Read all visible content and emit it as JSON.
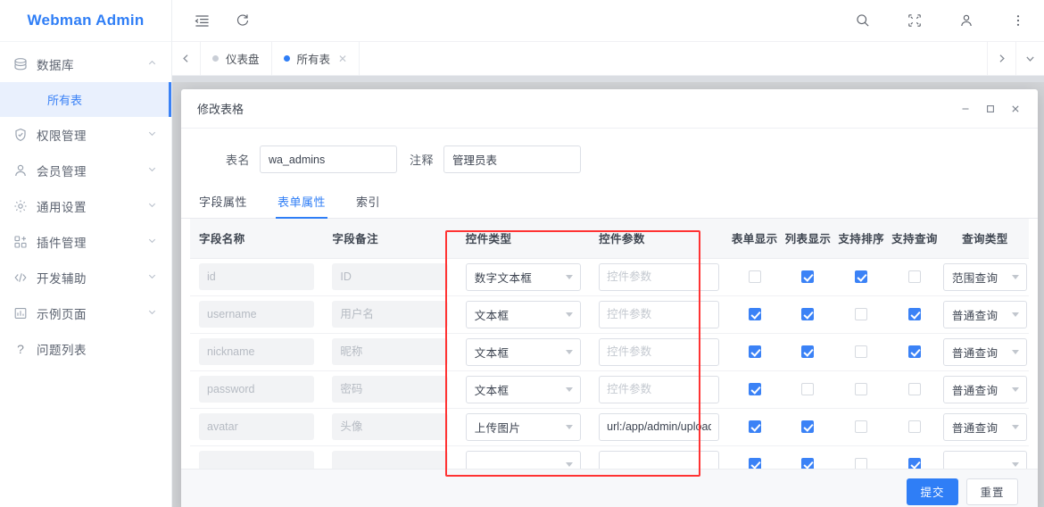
{
  "brand": "Webman Admin",
  "sidebar": {
    "items": [
      {
        "label": "数据库",
        "icon": "database-icon",
        "expanded": true,
        "chevron": "︿"
      },
      {
        "label": "权限管理",
        "icon": "shield-check-icon",
        "expanded": false,
        "chevron": "﹀"
      },
      {
        "label": "会员管理",
        "icon": "user-icon",
        "expanded": false,
        "chevron": "﹀"
      },
      {
        "label": "通用设置",
        "icon": "gear-icon",
        "expanded": false,
        "chevron": "﹀"
      },
      {
        "label": "插件管理",
        "icon": "plugin-icon",
        "expanded": false,
        "chevron": "﹀"
      },
      {
        "label": "开发辅助",
        "icon": "code-icon",
        "expanded": false,
        "chevron": "﹀"
      },
      {
        "label": "示例页面",
        "icon": "chart-icon",
        "expanded": false,
        "chevron": "﹀"
      },
      {
        "label": "问题列表",
        "icon": "question-icon",
        "expanded": false,
        "chevron": ""
      }
    ],
    "sub_item": "所有表"
  },
  "topbar": {
    "menu_icon": "menu-fold-icon",
    "refresh_icon": "refresh-icon",
    "search_icon": "search-icon",
    "fullscreen_icon": "fullscreen-icon",
    "user_icon": "user-icon",
    "more_icon": "more-vertical-icon"
  },
  "tabbar": {
    "prev_icon": "chevron-left-icon",
    "next_icon": "chevron-right-icon",
    "dropdown_icon": "chevron-down-icon",
    "tabs": [
      {
        "label": "仪表盘",
        "active": false,
        "closable": false
      },
      {
        "label": "所有表",
        "active": true,
        "closable": true,
        "close": "✕"
      }
    ]
  },
  "dialog": {
    "title": "修改表格",
    "minimize": "—",
    "maximize": "❐",
    "close": "✕",
    "form": {
      "table_name_label": "表名",
      "table_name_value": "wa_admins",
      "comment_label": "注释",
      "comment_value": "管理员表"
    },
    "tabs": [
      {
        "label": "字段属性",
        "active": false
      },
      {
        "label": "表单属性",
        "active": true
      },
      {
        "label": "索引",
        "active": false
      }
    ],
    "table": {
      "headers": {
        "field_name": "字段名称",
        "field_remark": "字段备注",
        "widget_type": "控件类型",
        "widget_param": "控件参数",
        "form_show": "表单显示",
        "list_show": "列表显示",
        "sortable": "支持排序",
        "searchable": "支持查询",
        "query_type": "查询类型"
      },
      "param_placeholder": "控件参数",
      "rows": [
        {
          "field_name": "id",
          "field_remark": "ID",
          "widget_type": "数字文本框",
          "widget_param": "",
          "form_show": false,
          "list_show": true,
          "sortable": true,
          "searchable": false,
          "query_type": "范围查询"
        },
        {
          "field_name": "username",
          "field_remark": "用户名",
          "widget_type": "文本框",
          "widget_param": "",
          "form_show": true,
          "list_show": true,
          "sortable": false,
          "searchable": true,
          "query_type": "普通查询"
        },
        {
          "field_name": "nickname",
          "field_remark": "昵称",
          "widget_type": "文本框",
          "widget_param": "",
          "form_show": true,
          "list_show": true,
          "sortable": false,
          "searchable": true,
          "query_type": "普通查询"
        },
        {
          "field_name": "password",
          "field_remark": "密码",
          "widget_type": "文本框",
          "widget_param": "",
          "form_show": true,
          "list_show": false,
          "sortable": false,
          "searchable": false,
          "query_type": "普通查询"
        },
        {
          "field_name": "avatar",
          "field_remark": "头像",
          "widget_type": "上传图片",
          "widget_param": "url:/app/admin/upload",
          "form_show": true,
          "list_show": true,
          "sortable": false,
          "searchable": false,
          "query_type": "普通查询"
        },
        {
          "field_name": "",
          "field_remark": "",
          "widget_type": "",
          "widget_param": "",
          "form_show": true,
          "list_show": true,
          "sortable": false,
          "searchable": true,
          "query_type": ""
        }
      ]
    },
    "footer": {
      "submit": "提交",
      "reset": "重置"
    }
  },
  "colors": {
    "brand_blue": "#2f7ef6",
    "accent_blue": "#3b82f6",
    "highlight_red": "#ff3333",
    "active_bg": "#e9f0fd"
  }
}
